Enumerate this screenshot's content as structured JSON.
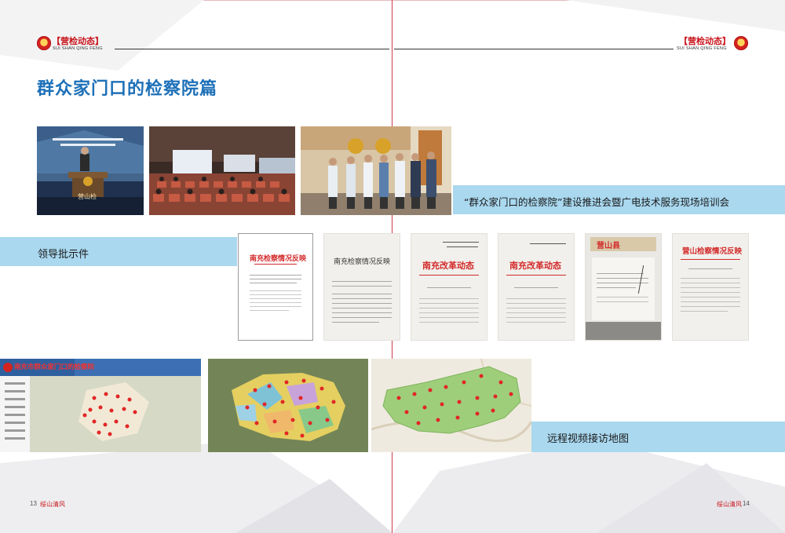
{
  "header": {
    "left_title": "【营检动态】",
    "left_sub": "SUI SHAN QING FENG",
    "right_title": "【营检动态】",
    "right_sub": "SUI SHAN QING FENG"
  },
  "page_title": "群众家门口的检察院篇",
  "photo_stage_text": "营山检",
  "training_caption": "“群众家门口的检察院”建设推进会暨广电技术服务现场培训会",
  "leader_caption": "领导批示件",
  "documents": [
    {
      "heading": "南充检察情况反映",
      "style": "red"
    },
    {
      "heading": "南充检察情况反映",
      "style": "black"
    },
    {
      "heading": "南充改革动态",
      "style": "red"
    },
    {
      "heading": "南充改革动态",
      "style": "red"
    },
    {
      "heading": "营山县",
      "style": "red"
    },
    {
      "heading": "营山检察情况反映",
      "style": "red"
    }
  ],
  "map_system_title": "南充市群众家门口的检察院",
  "map_caption": "远程视频接访地图",
  "footer": {
    "left_page": "13",
    "left_name": "绥山清风",
    "right_name": "绥山清风",
    "right_page": "14"
  }
}
